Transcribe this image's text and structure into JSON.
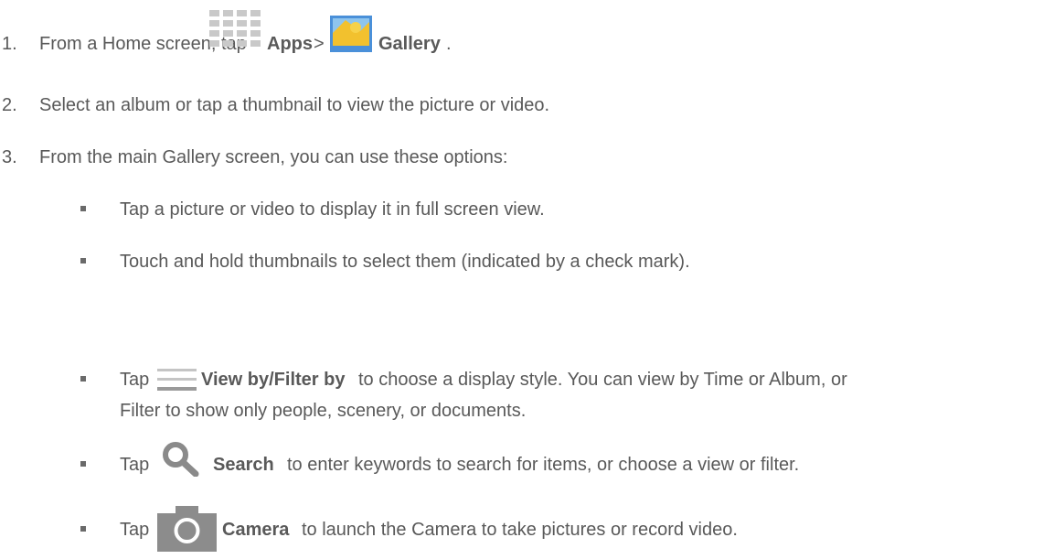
{
  "steps": [
    {
      "number": "1.",
      "prefix": "From a Home screen, tap",
      "apps_label": "Apps",
      "sep": ">",
      "gallery_label": "Gallery",
      "suffix": "."
    },
    {
      "number": "2.",
      "text": "Select an album or tap a thumbnail to view the picture or video."
    },
    {
      "number": "3.",
      "text": "From the main Gallery screen, you can use these options:"
    }
  ],
  "options": {
    "full_screen": "Tap a picture or video to display it in full screen view.",
    "select": "Touch and hold thumbnails to select them (indicated by a check mark).",
    "view_by": {
      "tap": "Tap",
      "label": "View by/Filter by",
      "rest_line1": "to choose a display style. You can view by Time or Album, or",
      "rest_line2": "Filter to show only people, scenery, or documents."
    },
    "search": {
      "tap": "Tap",
      "label": "Search",
      "rest": "to enter keywords to search for items, or choose a view or filter."
    },
    "camera": {
      "tap": "Tap",
      "label": "Camera",
      "rest": "to launch the Camera to take pictures or record video."
    }
  },
  "icons": {
    "apps": "apps-grid-icon",
    "gallery": "gallery-icon",
    "view_by": "menu-lines-icon",
    "search": "search-icon",
    "camera": "camera-icon"
  },
  "colors": {
    "text": "#595959",
    "icon_gray": "#bdbdbd",
    "gallery_blue": "#4a90d9",
    "gallery_yellow": "#f2c12e"
  }
}
